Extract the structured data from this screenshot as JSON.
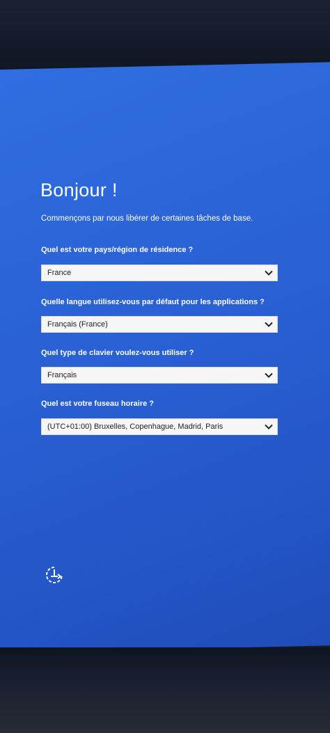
{
  "header": {
    "title": "Bonjour !",
    "subtitle": "Commençons par nous libérer de certaines tâches de base."
  },
  "questions": [
    {
      "label": "Quel est votre pays/région de résidence ?",
      "value": "France"
    },
    {
      "label": "Quelle langue utilisez-vous par défaut pour les applications ?",
      "value": "Français (France)"
    },
    {
      "label": "Quel type de clavier voulez-vous utiliser ?",
      "value": "Français"
    },
    {
      "label": "Quel est votre fuseau horaire ?",
      "value": "(UTC+01:00) Bruxelles, Copenhague, Madrid, Paris"
    }
  ],
  "icons": {
    "dropdown": "chevron-down-icon",
    "ease_of_access": "ease-of-access-icon"
  },
  "colors": {
    "screen_background": "#2a62d6",
    "text": "#ffffff",
    "dropdown_background": "#f6f6f6"
  }
}
